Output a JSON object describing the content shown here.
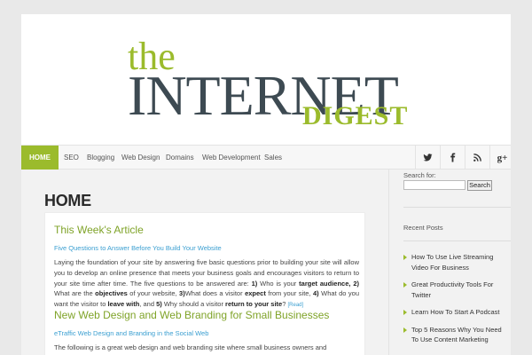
{
  "logo": {
    "the": "the",
    "internet": "INTERNET",
    "digest": "DIGEST"
  },
  "nav": {
    "items": [
      "HOME",
      "SEO",
      "Blogging",
      "Web Design",
      "Domains",
      "Web Development",
      "Sales"
    ],
    "active": "HOME",
    "accent_color": "#9bbb2c",
    "social_icons": [
      "twitter-icon",
      "facebook-icon",
      "rss-icon",
      "google-plus-icon"
    ]
  },
  "main": {
    "page_title": "HOME",
    "section1": {
      "heading": "This Week's Article",
      "link": "Five Questions to Answer Before You Build Your Website",
      "para_a": "Laying the foundation of your site by answering five basic questions prior to building your site will allow you to develop an online presence that meets your business goals and encourages visitors to return to your site time after time. The five questions to be answered are: ",
      "q1_num": "1)",
      "q1_text": " Who is your ",
      "q1_bold": "target audience",
      "q2_num": ", 2)",
      "q2_text": " What are the ",
      "q2_bold": "objectives",
      "q3_lead": " of your website, ",
      "q3_num": "3)",
      "q3_text": "What does a visitor ",
      "q3_bold": "expect",
      "q4_lead": " from your site, ",
      "q4_num": "4)",
      "q4_text": " What do you want the visitor to ",
      "q4_bold": "leave with",
      "q5_lead": ", and ",
      "q5_num": "5)",
      "q5_text": " Why should a visitor ",
      "q5_bold": "return to your site",
      "q5_end": "? ",
      "read_more": "[Read]"
    },
    "section2": {
      "heading": "New Web Design and Web Branding for Small Businesses",
      "link": "eTraffic Web Design and Branding in the Social Web",
      "para": "The following is a great web design and web branding site where small business owners and"
    }
  },
  "sidebar": {
    "search_label": "Search for:",
    "search_value": "",
    "search_button": "Search",
    "recent_title": "Recent Posts",
    "recent_posts": [
      "How To Use Live Streaming Video For Business",
      "Great Productivity Tools For Twitter",
      "Learn How To Start A Podcast",
      "Top 5 Reasons Why You Need To Use Content Marketing"
    ]
  }
}
